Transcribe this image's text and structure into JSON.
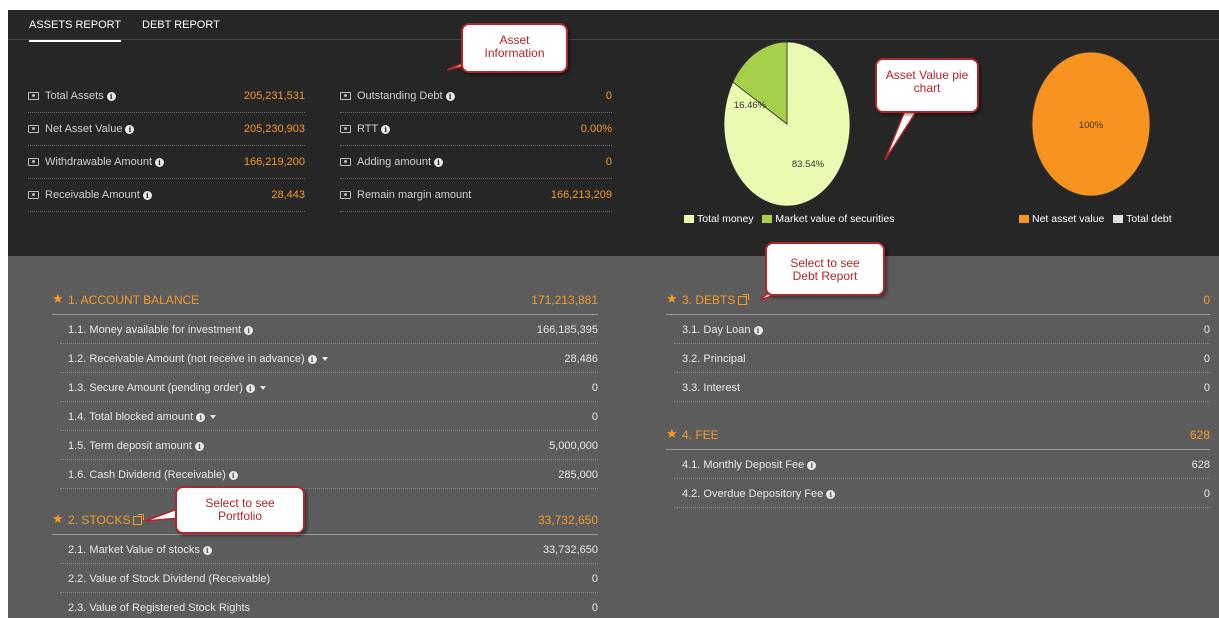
{
  "tabs": [
    {
      "label": "ASSETS REPORT",
      "active": true
    },
    {
      "label": "DEBT REPORT",
      "active": false
    }
  ],
  "asset_info": {
    "left": [
      {
        "label": "Total Assets",
        "info": true,
        "value": "205,231,531"
      },
      {
        "label": "Net Asset Value",
        "info": true,
        "value": "205,230,903"
      },
      {
        "label": "Withdrawable Amount",
        "info": true,
        "value": "166,219,200"
      },
      {
        "label": "Receivable Amount",
        "info": true,
        "value": "28,443"
      }
    ],
    "right": [
      {
        "label": "Outstanding Debt",
        "info": true,
        "value": "0"
      },
      {
        "label": "RTT",
        "info": true,
        "value": "0.00%"
      },
      {
        "label": "Adding amount",
        "info": true,
        "value": "0"
      },
      {
        "label": "Remain margin amount",
        "info": false,
        "value": "166,213,209"
      }
    ]
  },
  "pie_asset": {
    "slices": [
      {
        "name": "Total money",
        "percent": 83.54,
        "label": "83.54%",
        "color": "#eafab0"
      },
      {
        "name": "Market value of securities",
        "percent": 16.46,
        "label": "16.46%",
        "color": "#a7d04a"
      }
    ]
  },
  "pie_nav": {
    "slices": [
      {
        "name": "Net asset value",
        "percent": 100,
        "label": "100%",
        "color": "#f7931e"
      },
      {
        "name": "Total debt",
        "percent": 0,
        "label": "",
        "color": "#e0e0e0"
      }
    ]
  },
  "callouts": {
    "asset_info": "Asset Information",
    "pie_chart": "Asset Value pie chart",
    "debt_report": "Select to see Debt Report",
    "portfolio": "Select to see Portfolio"
  },
  "sections": {
    "account_balance": {
      "title": "1. ACCOUNT BALANCE",
      "total": "171,213,881",
      "rows": [
        {
          "label": "1.1. Money available for investment",
          "info": true,
          "caret": false,
          "value": "166,185,395"
        },
        {
          "label": "1.2. Receivable Amount (not receive in advance)",
          "info": true,
          "caret": true,
          "value": "28,486"
        },
        {
          "label": "1.3. Secure Amount (pending order)",
          "info": true,
          "caret": true,
          "value": "0"
        },
        {
          "label": "1.4. Total blocked amount",
          "info": true,
          "caret": true,
          "value": "0"
        },
        {
          "label": "1.5. Term deposit amount",
          "info": true,
          "caret": false,
          "value": "5,000,000"
        },
        {
          "label": "1.6. Cash Dividend (Receivable)",
          "info": true,
          "caret": false,
          "value": "285,000"
        }
      ]
    },
    "stocks": {
      "title": "2. STOCKS",
      "total": "33,732,650",
      "rows": [
        {
          "label": "2.1. Market Value of stocks",
          "info": true,
          "caret": false,
          "value": "33,732,650"
        },
        {
          "label": "2.2. Value of Stock Dividend (Receivable)",
          "info": false,
          "caret": false,
          "value": "0"
        },
        {
          "label": "2.3. Value of Registered Stock Rights",
          "info": false,
          "caret": false,
          "value": "0"
        }
      ]
    },
    "debts": {
      "title": "3. DEBTS",
      "total": "0",
      "rows": [
        {
          "label": "3.1. Day Loan",
          "info": true,
          "caret": false,
          "value": "0"
        },
        {
          "label": "3.2. Principal",
          "info": false,
          "caret": false,
          "value": "0"
        },
        {
          "label": "3.3. Interest",
          "info": false,
          "caret": false,
          "value": "0"
        }
      ]
    },
    "fee": {
      "title": "4. FEE",
      "total": "628",
      "rows": [
        {
          "label": "4.1. Monthly Deposit Fee",
          "info": true,
          "caret": false,
          "value": "628"
        },
        {
          "label": "4.2. Overdue Depository Fee",
          "info": true,
          "caret": false,
          "value": "0"
        }
      ]
    }
  },
  "colors": {
    "accent": "#f39a2b",
    "callout_border": "#b4242a",
    "panel_dark": "#262626",
    "panel_gray": "#5c5c5c"
  },
  "icons": {
    "info": "info-icon",
    "star": "star-icon",
    "external": "external-link-icon",
    "card": "money-card-icon",
    "caret": "caret-down-icon"
  }
}
